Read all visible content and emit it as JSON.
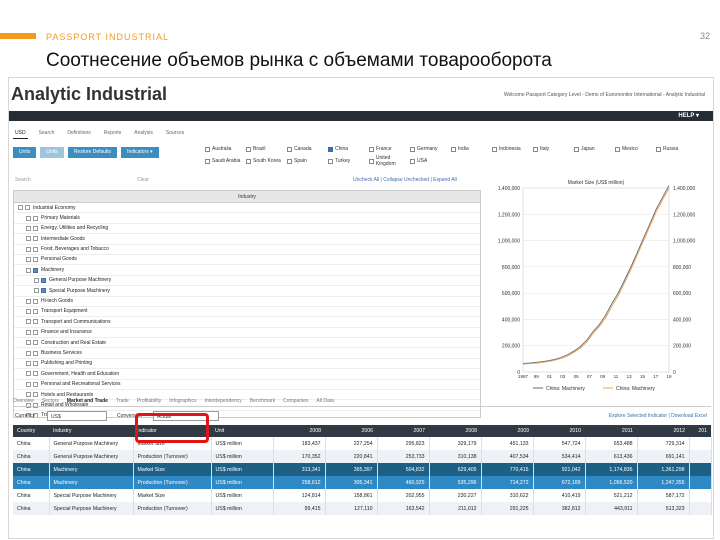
{
  "slide": {
    "label": "PASSPORT INDUSTRIAL",
    "title": "Соотнесение объемов рынка с объемами товарооборота",
    "page_number": "32",
    "accent": "#f39a1d"
  },
  "app": {
    "brand": "Analytic Industrial",
    "welcome": "Welcome Passport Category Level - Demo of Euromonitor International - Analytic Industrial",
    "help_label": "HELP ▾",
    "top_tabs": [
      "USD",
      "Search",
      "Definitions",
      "Reports",
      "Analysis",
      "Sources"
    ],
    "buttons": {
      "b1": "Units",
      "b2": "Units",
      "b3": "Restore Defaults",
      "b4": "Indicators ▾"
    },
    "countries": [
      "Australia",
      "Brazil",
      "Canada",
      "China",
      "France",
      "Germany",
      "India",
      "Indonesia",
      "Italy",
      "Japan",
      "Mexico",
      "Russia",
      "Saudi Arabia",
      "South Korea",
      "Spain",
      "Turkey",
      "United Kingdom",
      "USA"
    ],
    "checked_country": "China",
    "search_placeholder": "Search",
    "clear_label": "Clear",
    "tree_links": "Uncheck All  |  Collapse Unchecked  |  Expand All",
    "tree_header": "Industry"
  },
  "tree": [
    {
      "label": "Industrial Economy",
      "indent": 0,
      "checked": false
    },
    {
      "label": "Primary Materials",
      "indent": 1,
      "checked": false
    },
    {
      "label": "Energy, Utilities and Recycling",
      "indent": 1,
      "checked": false
    },
    {
      "label": "Intermediate Goods",
      "indent": 1,
      "checked": false
    },
    {
      "label": "Food, Beverages and Tobacco",
      "indent": 1,
      "checked": false
    },
    {
      "label": "Personal Goods",
      "indent": 1,
      "checked": false
    },
    {
      "label": "Machinery",
      "indent": 1,
      "checked": true
    },
    {
      "label": "General Purpose Machinery",
      "indent": 2,
      "checked": true
    },
    {
      "label": "Special Purpose Machinery",
      "indent": 2,
      "checked": true
    },
    {
      "label": "Hi-tech Goods",
      "indent": 1,
      "checked": false
    },
    {
      "label": "Transport Equipment",
      "indent": 1,
      "checked": false
    },
    {
      "label": "Transport and Communications",
      "indent": 1,
      "checked": false
    },
    {
      "label": "Finance and Insurance",
      "indent": 1,
      "checked": false
    },
    {
      "label": "Construction and Real Estate",
      "indent": 1,
      "checked": false
    },
    {
      "label": "Business Services",
      "indent": 1,
      "checked": false
    },
    {
      "label": "Publishing and Printing",
      "indent": 1,
      "checked": false
    },
    {
      "label": "Government, Health and Education",
      "indent": 1,
      "checked": false
    },
    {
      "label": "Personal and Recreational Services",
      "indent": 1,
      "checked": false
    },
    {
      "label": "Hotels and Restaurants",
      "indent": 1,
      "checked": false
    },
    {
      "label": "Retail and Wholesale",
      "indent": 1,
      "checked": false
    },
    {
      "label": "Travel and Tourism",
      "indent": 1,
      "checked": false
    }
  ],
  "chart_data": {
    "type": "line",
    "title": "Market Size (US$ million)",
    "x": [
      1997,
      1998,
      1999,
      2000,
      2001,
      2002,
      2003,
      2004,
      2005,
      2006,
      2007,
      2008,
      2009,
      2010,
      2011,
      2012,
      2013,
      2014,
      2015,
      2016,
      2017,
      2018,
      2019,
      2020
    ],
    "series": [
      {
        "name": "China: Machinery",
        "color": "#5f6b7a",
        "values": [
          65000,
          68000,
          72000,
          78000,
          86000,
          96000,
          110000,
          130000,
          158000,
          192000,
          240000,
          305000,
          360000,
          430000,
          521000,
          600000,
          700000,
          800000,
          910000,
          1020000,
          1130000,
          1240000,
          1330000,
          1420000
        ]
      },
      {
        "name": "China: Machinery",
        "color": "#f3a04a",
        "values": [
          60000,
          63000,
          67000,
          73000,
          80000,
          90000,
          103000,
          122000,
          148000,
          180000,
          226000,
          290000,
          345000,
          410000,
          500000,
          580000,
          680000,
          780000,
          890000,
          1000000,
          1110000,
          1220000,
          1310000,
          1400000
        ]
      }
    ],
    "left_axis_ticks": [
      "1,400,000",
      "1,200,000",
      "1,000,000",
      "800,000",
      "600,000",
      "400,000",
      "200,000",
      "0"
    ],
    "right_axis_ticks": [
      "1,400,000",
      "1,200,000",
      "1,000,000",
      "800,000",
      "600,000",
      "400,000",
      "200,000",
      "0"
    ],
    "x_tick_labels": [
      "1997",
      "99",
      "01",
      "03",
      "05",
      "07",
      "09",
      "11",
      "13",
      "15",
      "17",
      "19"
    ],
    "ylim": [
      0,
      1400000
    ],
    "grid": true,
    "legend": "bottom"
  },
  "lower": {
    "tabs": [
      "Overview",
      "Sectors",
      "Market and Trade",
      "Trade",
      "Profitability",
      "Infographics",
      "Interdependency",
      "Benchmark",
      "Companies",
      "All Data"
    ],
    "active_tab": "Market and Trade",
    "currency_label": "Currency",
    "currency_value": "US$",
    "conversion_label": "Conversion",
    "conversion_value": "Actual",
    "right_links": "Explore Selected Indicator  |  Download Excel"
  },
  "table": {
    "headers": [
      "Country",
      "Industry",
      "Indicator",
      "Unit",
      "2008",
      "2006",
      "2007",
      "2008",
      "2009",
      "2010",
      "2011",
      "2012",
      "201"
    ],
    "rows": [
      [
        "China",
        "General Purpose Machinery",
        "Market Size",
        "US$ million",
        "183,437",
        "227,254",
        "295,823",
        "329,179",
        "451,133",
        "547,724",
        "653,488",
        "729,314",
        ""
      ],
      [
        "China",
        "General Purpose Machinery",
        "Production (Turnover)",
        "US$ million",
        "170,352",
        "220,841",
        "253,733",
        "310,138",
        "407,534",
        "534,414",
        "613,436",
        "691,141",
        ""
      ],
      [
        "China",
        "Machinery",
        "Market Size",
        "US$ million",
        "313,341",
        "365,397",
        "504,832",
        "629,405",
        "770,415",
        "921,042",
        "1,174,836",
        "1,361,298",
        ""
      ],
      [
        "China",
        "Machinery",
        "Production (Turnover)",
        "US$ million",
        "258,612",
        "305,341",
        "460,925",
        "535,296",
        "714,272",
        "672,189",
        "1,056,520",
        "1,247,355",
        ""
      ],
      [
        "China",
        "Special Purpose Machinery",
        "Market Size",
        "US$ million",
        "124,814",
        "158,861",
        "202,955",
        "230,227",
        "310,622",
        "410,419",
        "521,212",
        "587,172",
        ""
      ],
      [
        "China",
        "Special Purpose Machinery",
        "Production (Turnover)",
        "US$ million",
        "99,415",
        "127,110",
        "163,542",
        "211,012",
        "291,225",
        "382,812",
        "443,911",
        "513,323",
        ""
      ]
    ],
    "highlight_rows": [
      2,
      3
    ]
  }
}
